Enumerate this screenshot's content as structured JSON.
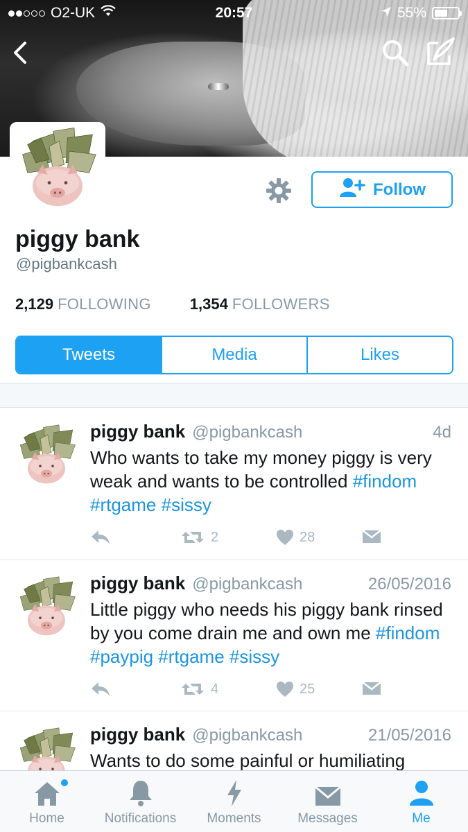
{
  "status_bar": {
    "carrier": "O2-UK",
    "time": "20:57",
    "battery": "55%",
    "battery_level": 0.55
  },
  "profile": {
    "display_name": "piggy bank",
    "handle": "@pigbankcash",
    "follow_label": "Follow",
    "following_count": "2,129",
    "following_label": "FOLLOWING",
    "followers_count": "1,354",
    "followers_label": "FOLLOWERS"
  },
  "tabs": [
    {
      "label": "Tweets",
      "active": true
    },
    {
      "label": "Media",
      "active": false
    },
    {
      "label": "Likes",
      "active": false
    }
  ],
  "tweets": [
    {
      "name": "piggy bank",
      "handle": "@pigbankcash",
      "time": "4d",
      "text": "Who wants to take my money piggy is very weak and wants to be controlled",
      "hashtags": "#findom #rtgame #sissy",
      "retweets": "2",
      "likes": "28"
    },
    {
      "name": "piggy bank",
      "handle": "@pigbankcash",
      "time": "26/05/2016",
      "text": "Little piggy who needs his piggy bank rinsed by you come drain me and own me",
      "hashtags": "#findom #paypig #rtgame #sissy",
      "retweets": "4",
      "likes": "25"
    },
    {
      "name": "piggy bank",
      "handle": "@pigbankcash",
      "time": "21/05/2016",
      "text": "Wants to do some painful or humiliating",
      "hashtags": "",
      "retweets": "",
      "likes": ""
    }
  ],
  "tab_bar": [
    {
      "label": "Home",
      "icon": "home-icon",
      "active": false
    },
    {
      "label": "Notifications",
      "icon": "bell-icon",
      "active": false
    },
    {
      "label": "Moments",
      "icon": "lightning-icon",
      "active": false
    },
    {
      "label": "Messages",
      "icon": "envelope-icon",
      "active": false
    },
    {
      "label": "Me",
      "icon": "person-icon",
      "active": true
    }
  ],
  "colors": {
    "accent": "#1da1f2",
    "hashtag": "#1b95e0",
    "muted": "#8899a6"
  }
}
